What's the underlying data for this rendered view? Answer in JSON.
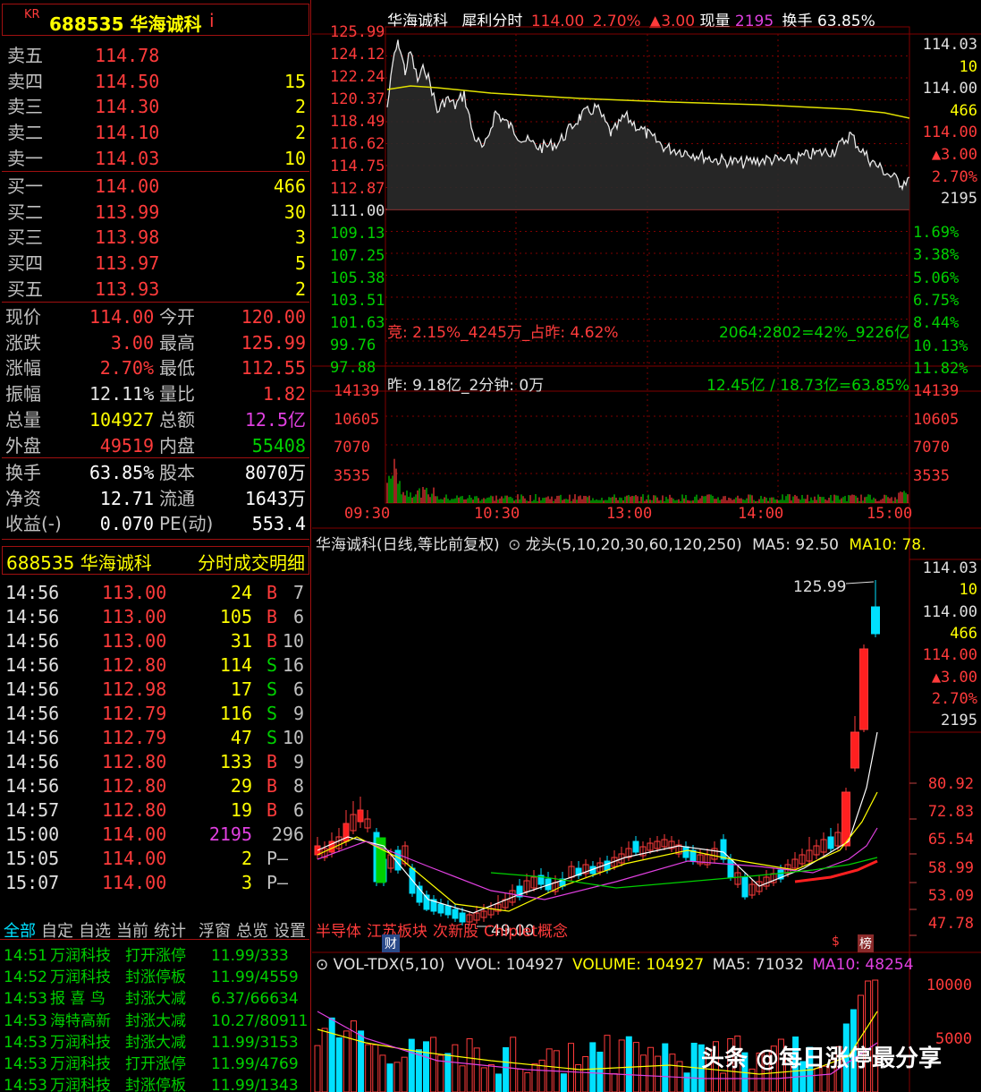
{
  "header": {
    "market": "KR",
    "code_name": "688535 华海诚科",
    "flag": "i"
  },
  "order_book": {
    "asks": [
      {
        "label": "卖五",
        "price": "114.78",
        "vol": ""
      },
      {
        "label": "卖四",
        "price": "114.50",
        "vol": "15"
      },
      {
        "label": "卖三",
        "price": "114.30",
        "vol": "2"
      },
      {
        "label": "卖二",
        "price": "114.10",
        "vol": "2"
      },
      {
        "label": "卖一",
        "price": "114.03",
        "vol": "10"
      }
    ],
    "bids": [
      {
        "label": "买一",
        "price": "114.00",
        "vol": "466"
      },
      {
        "label": "买二",
        "price": "113.99",
        "vol": "30"
      },
      {
        "label": "买三",
        "price": "113.98",
        "vol": "3"
      },
      {
        "label": "买四",
        "price": "113.97",
        "vol": "5"
      },
      {
        "label": "买五",
        "price": "113.93",
        "vol": "2"
      }
    ]
  },
  "stats": [
    {
      "l1": "现价",
      "v1": "114.00",
      "c1": "#ff3b3b",
      "l2": "今开",
      "v2": "120.00",
      "c2": "#ff3b3b"
    },
    {
      "l1": "涨跌",
      "v1": "3.00",
      "c1": "#ff3b3b",
      "l2": "最高",
      "v2": "125.99",
      "c2": "#ff3b3b"
    },
    {
      "l1": "涨幅",
      "v1": "2.70%",
      "c1": "#ff3b3b",
      "l2": "最低",
      "v2": "112.55",
      "c2": "#ff3b3b"
    },
    {
      "l1": "振幅",
      "v1": "12.11%",
      "c1": "#e0e0e0",
      "l2": "量比",
      "v2": "1.82",
      "c2": "#ff3b3b"
    },
    {
      "l1": "总量",
      "v1": "104927",
      "c1": "#ffff00",
      "l2": "总额",
      "v2": "12.5亿",
      "c2": "#e040e0"
    },
    {
      "l1": "外盘",
      "v1": "49519",
      "c1": "#ff3b3b",
      "l2": "内盘",
      "v2": "55408",
      "c2": "#00d000"
    }
  ],
  "fundamentals": [
    {
      "l1": "换手",
      "v1": "63.85%",
      "l2": "股本",
      "v2": "8070万"
    },
    {
      "l1": "净资",
      "v1": "12.71",
      "l2": "流通",
      "v2": "1643万"
    },
    {
      "l1": "收益(-)",
      "v1": "0.070",
      "l2": "PE(动)",
      "v2": "553.4"
    }
  ],
  "trades_header": {
    "code_name": "688535 华海诚科",
    "title": "分时成交明细"
  },
  "trades": [
    {
      "time": "14:56",
      "price": "113.00",
      "vol": "24",
      "side": "B",
      "cnt": "7",
      "pc": "#ff3b3b",
      "vc": "#ffff00",
      "sc": "#ff3b3b"
    },
    {
      "time": "14:56",
      "price": "113.00",
      "vol": "105",
      "side": "B",
      "cnt": "6",
      "pc": "#ff3b3b",
      "vc": "#ffff00",
      "sc": "#ff3b3b"
    },
    {
      "time": "14:56",
      "price": "113.00",
      "vol": "31",
      "side": "B",
      "cnt": "10",
      "pc": "#ff3b3b",
      "vc": "#ffff00",
      "sc": "#ff3b3b"
    },
    {
      "time": "14:56",
      "price": "112.80",
      "vol": "114",
      "side": "S",
      "cnt": "16",
      "pc": "#ff3b3b",
      "vc": "#ffff00",
      "sc": "#00d000"
    },
    {
      "time": "14:56",
      "price": "112.98",
      "vol": "17",
      "side": "S",
      "cnt": "6",
      "pc": "#ff3b3b",
      "vc": "#ffff00",
      "sc": "#00d000"
    },
    {
      "time": "14:56",
      "price": "112.79",
      "vol": "116",
      "side": "S",
      "cnt": "9",
      "pc": "#ff3b3b",
      "vc": "#ffff00",
      "sc": "#00d000"
    },
    {
      "time": "14:56",
      "price": "112.79",
      "vol": "47",
      "side": "S",
      "cnt": "10",
      "pc": "#ff3b3b",
      "vc": "#ffff00",
      "sc": "#00d000"
    },
    {
      "time": "14:56",
      "price": "112.80",
      "vol": "133",
      "side": "B",
      "cnt": "9",
      "pc": "#ff3b3b",
      "vc": "#ffff00",
      "sc": "#ff3b3b"
    },
    {
      "time": "14:56",
      "price": "112.80",
      "vol": "29",
      "side": "B",
      "cnt": "8",
      "pc": "#ff3b3b",
      "vc": "#ffff00",
      "sc": "#ff3b3b"
    },
    {
      "time": "14:57",
      "price": "112.80",
      "vol": "19",
      "side": "B",
      "cnt": "6",
      "pc": "#ff3b3b",
      "vc": "#ffff00",
      "sc": "#ff3b3b"
    },
    {
      "time": "15:00",
      "price": "114.00",
      "vol": "2195",
      "side": "",
      "cnt": "296",
      "pc": "#ff3b3b",
      "vc": "#e040e0",
      "sc": "#ff3b3b"
    },
    {
      "time": "15:05",
      "price": "114.00",
      "vol": "2",
      "side": "P—",
      "cnt": "",
      "pc": "#ff3b3b",
      "vc": "#ffff00",
      "sc": "#c0c0c0"
    },
    {
      "time": "15:07",
      "price": "114.00",
      "vol": "3",
      "side": "P—",
      "cnt": "",
      "pc": "#ff3b3b",
      "vc": "#ffff00",
      "sc": "#c0c0c0"
    }
  ],
  "bottom_tabs": [
    "全部",
    "自定",
    "自选",
    "当前",
    "统计",
    "浮窗",
    "总览",
    "设置"
  ],
  "alerts": [
    {
      "time": "14:51",
      "name": "万润科技",
      "event": "打开涨停",
      "value": "11.99/333"
    },
    {
      "time": "14:52",
      "name": "万润科技",
      "event": "封涨停板",
      "value": "11.99/4559"
    },
    {
      "time": "14:53",
      "name": "报 喜 鸟",
      "event": "封涨大减",
      "value": "6.37/66634"
    },
    {
      "time": "14:53",
      "name": "海特高新",
      "event": "封涨大减",
      "value": "10.27/80911"
    },
    {
      "time": "14:53",
      "name": "万润科技",
      "event": "封涨大减",
      "value": "11.99/3153"
    },
    {
      "time": "14:53",
      "name": "万润科技",
      "event": "打开涨停",
      "value": "11.99/4769"
    },
    {
      "time": "14:53",
      "name": "万润科技",
      "event": "封涨停板",
      "value": "11.99/1343"
    }
  ],
  "intraday": {
    "title_name": "华海诚科",
    "title_mode": "犀利分时",
    "title_price": "114.00",
    "title_pct": "2.70%",
    "title_chg": "▲3.00",
    "title_now_label": "现量",
    "title_now": "2195",
    "title_turnover": "换手 63.85%",
    "left_axis": [
      "125.99",
      "124.12",
      "122.24",
      "120.37",
      "118.49",
      "116.62",
      "114.75",
      "112.87",
      "111.00",
      "109.13",
      "107.25",
      "105.38",
      "103.51",
      "101.63",
      "99.76",
      "97.88"
    ],
    "right_axis_quote": [
      "114.03",
      "10",
      "114.00",
      "466",
      "114.00",
      "▲3.00",
      "2.70%",
      "2195"
    ],
    "right_axis_pct": [
      "1.69%",
      "3.38%",
      "5.06%",
      "6.75%",
      "8.44%",
      "10.13%",
      "11.82%"
    ],
    "auction_text": "竞: 2.15%_4245万_占昨: 4.62%",
    "ratio_text": "2064:2802=42%_9226亿",
    "yesterday_text": "昨: 9.18亿_2分钟: 0万",
    "turnover_text": "12.45亿 / 18.73亿=63.85%",
    "vol_axis": [
      "14139",
      "10605",
      "7070",
      "3535"
    ],
    "time_axis": [
      "09:30",
      "10:30",
      "13:00",
      "14:00",
      "15:00"
    ],
    "colors": {
      "price_line": "#e0e0e0",
      "avg_line": "#e0e000",
      "grid": "#800000"
    }
  },
  "daily": {
    "title": "华海诚科(日线,等比前复权)",
    "indicator": "龙头(5,10,20,30,60,120,250)",
    "ma5": "MA5: 92.50",
    "ma10": "MA10: 78.",
    "high_label": "125.99",
    "low_label": "49.00",
    "right_axis_quote": [
      "114.03",
      "10",
      "114.00",
      "466",
      "114.00",
      "▲3.00",
      "2.70%",
      "2195"
    ],
    "right_axis": [
      "80.92",
      "72.83",
      "65.54",
      "58.99",
      "53.09",
      "47.78"
    ],
    "concepts": [
      {
        "text": "半导体",
        "color": "#ff3b3b"
      },
      {
        "text": "江苏板块",
        "color": "#ff3b3b"
      },
      {
        "text": "次新股",
        "color": "#ff3b3b"
      },
      {
        "text": "Chiplet概念",
        "color": "#ff3b3b"
      }
    ],
    "badge_fin": "财",
    "badge_s": "$",
    "badge_rank": "榜"
  },
  "volume_panel": {
    "title": "VOL-TDX(5,10)",
    "vvol": "VVOL: 104927",
    "volume": "VOLUME: 104927",
    "ma5": "MA5: 71032",
    "ma10": "MA10: 48254",
    "axis": [
      "10000",
      "5000"
    ]
  },
  "watermark": "头条 @每日涨停最分享"
}
